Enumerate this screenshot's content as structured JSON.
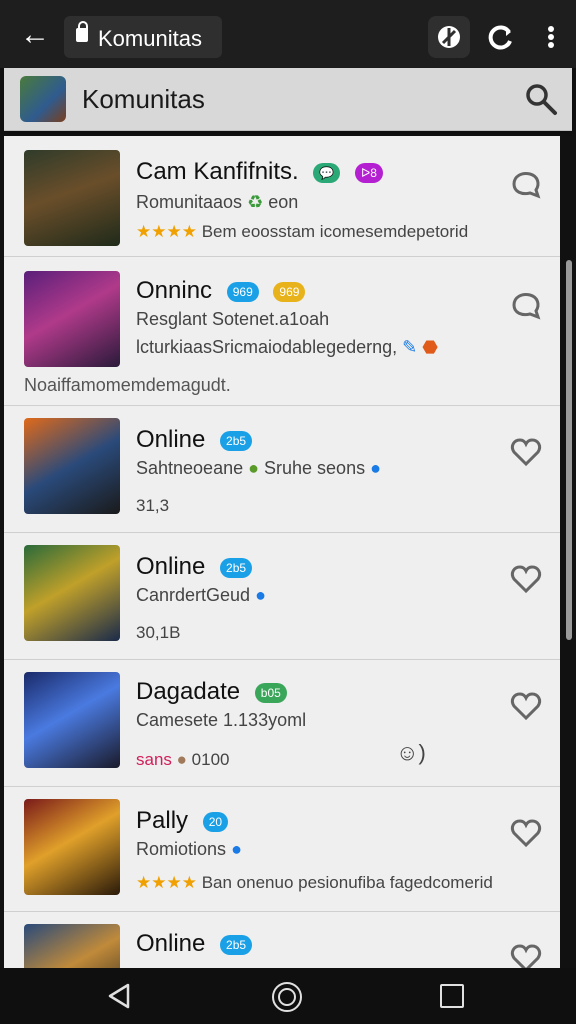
{
  "browser": {
    "url_text": "Komunitas"
  },
  "header": {
    "title": "Komunitas"
  },
  "items": [
    {
      "name": "Cam Kanfifnits.",
      "sub": "Romunitaaos",
      "sub_extra": "eon",
      "line3": "Bem eoosstam icomesemdepetorid",
      "stars": "★★★★",
      "badges": [
        {
          "text": "💬",
          "color": "#2aa876"
        },
        {
          "text": "ᐅ8",
          "color": "#b31fd1"
        }
      ]
    },
    {
      "name": "Onninc",
      "badges": [
        {
          "text": "969",
          "color": "#1aa0e6"
        },
        {
          "text": "969",
          "color": "#e8b21a"
        }
      ],
      "sub": "Resglant Sotenet.a1oah",
      "line3": "lcturkiaasSricmaiodablegederng,",
      "extra": "Noaiffamomemdemagudt."
    },
    {
      "name": "Online",
      "badges": [
        {
          "text": "2b5",
          "color": "#1aa0e6"
        }
      ],
      "sub": "Sahtneoeane",
      "sub_extra": "Sruhe seons",
      "line3": "31,3"
    },
    {
      "name": "Online",
      "badges": [
        {
          "text": "2b5",
          "color": "#1aa0e6"
        }
      ],
      "sub": "CanrdertGeud",
      "line3": "30,1B"
    },
    {
      "name": "Dagadate",
      "badges": [
        {
          "text": "b05",
          "color": "#3aa65a"
        }
      ],
      "sub": "Camesete 1.133yoml",
      "line3_red": "sans",
      "line3": "0100"
    },
    {
      "name": "Pally",
      "badges": [
        {
          "text": "20",
          "color": "#1aa0e6"
        }
      ],
      "sub": "Romiotions",
      "line3": "Ban onenuo pesionufiba fagedcomerid",
      "stars": "★★★★"
    },
    {
      "name": "Online",
      "badges": [
        {
          "text": "2b5",
          "color": "#1aa0e6"
        }
      ]
    }
  ],
  "colors": {
    "topbar": "#1e1e1e",
    "header": "#d8d8d8",
    "list": "#efefef"
  }
}
